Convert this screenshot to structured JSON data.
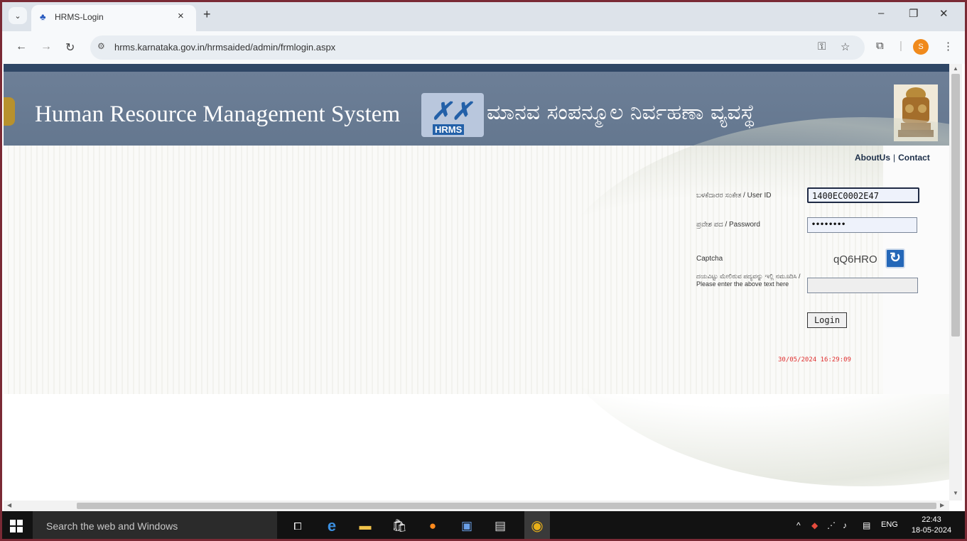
{
  "browser": {
    "tab_title": "HRMS-Login",
    "url": "hrms.karnataka.gov.in/hrmsaided/admin/frmlogin.aspx",
    "profile_initial": "S"
  },
  "banner": {
    "title": "Human Resource Management System",
    "logo_text": "HRMS",
    "kannada_title": "ಮಾನವ ಸಂಪನ್ಮೂಲ ನಿರ್ವಹಣಾ ವ್ಯವಸ್ಥೆ"
  },
  "links": {
    "about": "AboutUs",
    "separator": "|",
    "contact": "Contact"
  },
  "login_form": {
    "user_id_label": "ಬಳಕೆದಾರರ ಸಂಕೇತ / User ID",
    "user_id_value": "1400EC0002E47",
    "password_label": "ಪ್ರವೇಶ ಪದ / Password",
    "password_value": "••••••••",
    "captcha_label": "Captcha",
    "captcha_code": "qQ6HRO",
    "captcha_prompt": "ದಯವಿಟ್ಟು ಮೇಲಿರುವ ಪದ್ಯವನ್ನು ಇಲ್ಲಿ ನಮೂದಿಸಿ / Please enter the above text here",
    "captcha_value": "",
    "login_label": "Login",
    "datetime": "30/05/2024 16:29:09"
  },
  "taskbar": {
    "search_placeholder": "Search the web and Windows",
    "language": "ENG",
    "time": "22:43",
    "date": "18-05-2024"
  },
  "colors": {
    "banner": "#6d7f97",
    "frame": "#7a2a35",
    "taskbar": "#121212",
    "datetime": "#e03030"
  }
}
